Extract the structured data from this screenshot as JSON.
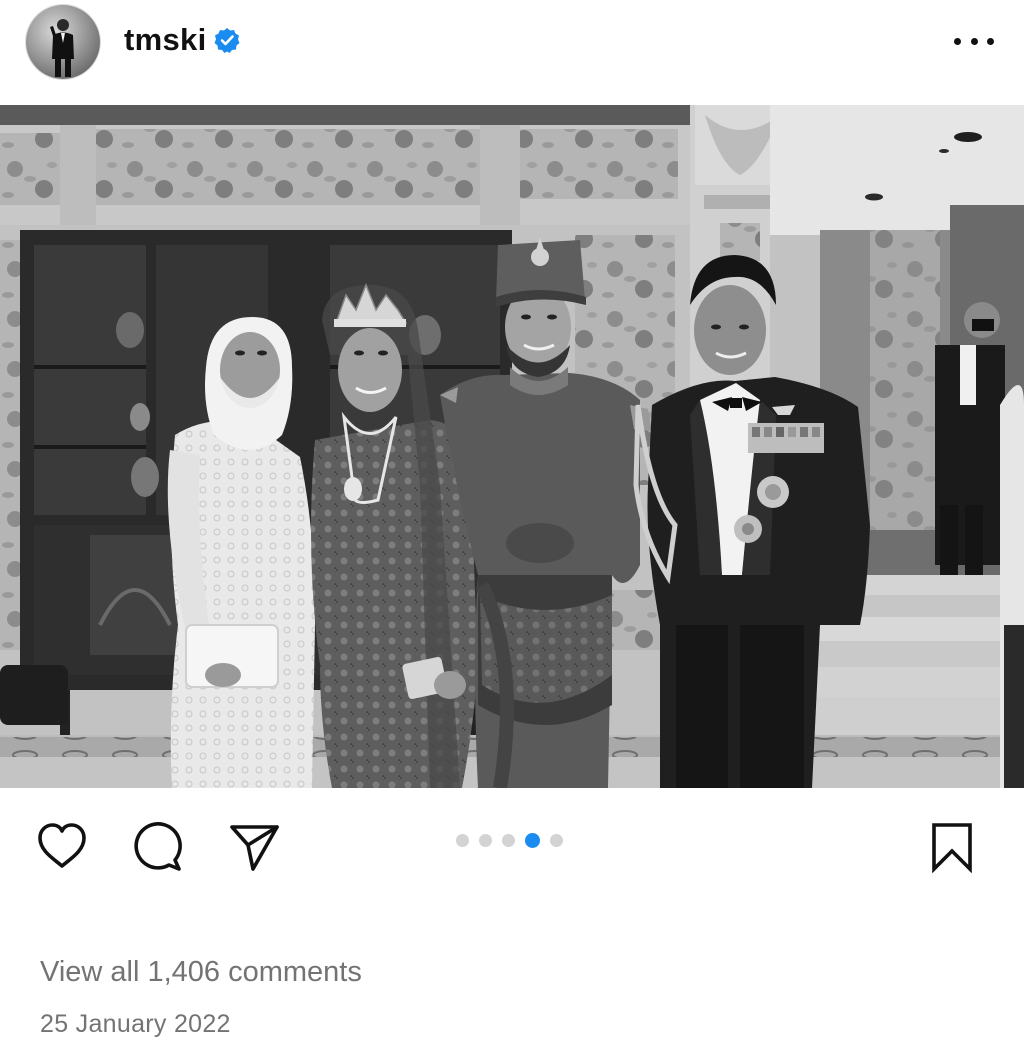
{
  "header": {
    "username": "tmski",
    "verified": true,
    "more_icon": "more-horizontal-icon"
  },
  "post": {
    "photo": {
      "style": "black-and-white",
      "people_count": 4
    },
    "carousel": {
      "total": 5,
      "current": 4
    },
    "actions": {
      "like_icon": "heart-icon",
      "comment_icon": "comment-bubble-icon",
      "share_icon": "paper-plane-icon",
      "save_icon": "bookmark-icon"
    },
    "comments_link": "View all 1,406 comments",
    "date": "25 January 2022"
  },
  "colors": {
    "accent": "#1a8cf0",
    "verified": "#1a8cf0",
    "muted_text": "#737373",
    "inactive_dot": "#d3d3d3"
  }
}
